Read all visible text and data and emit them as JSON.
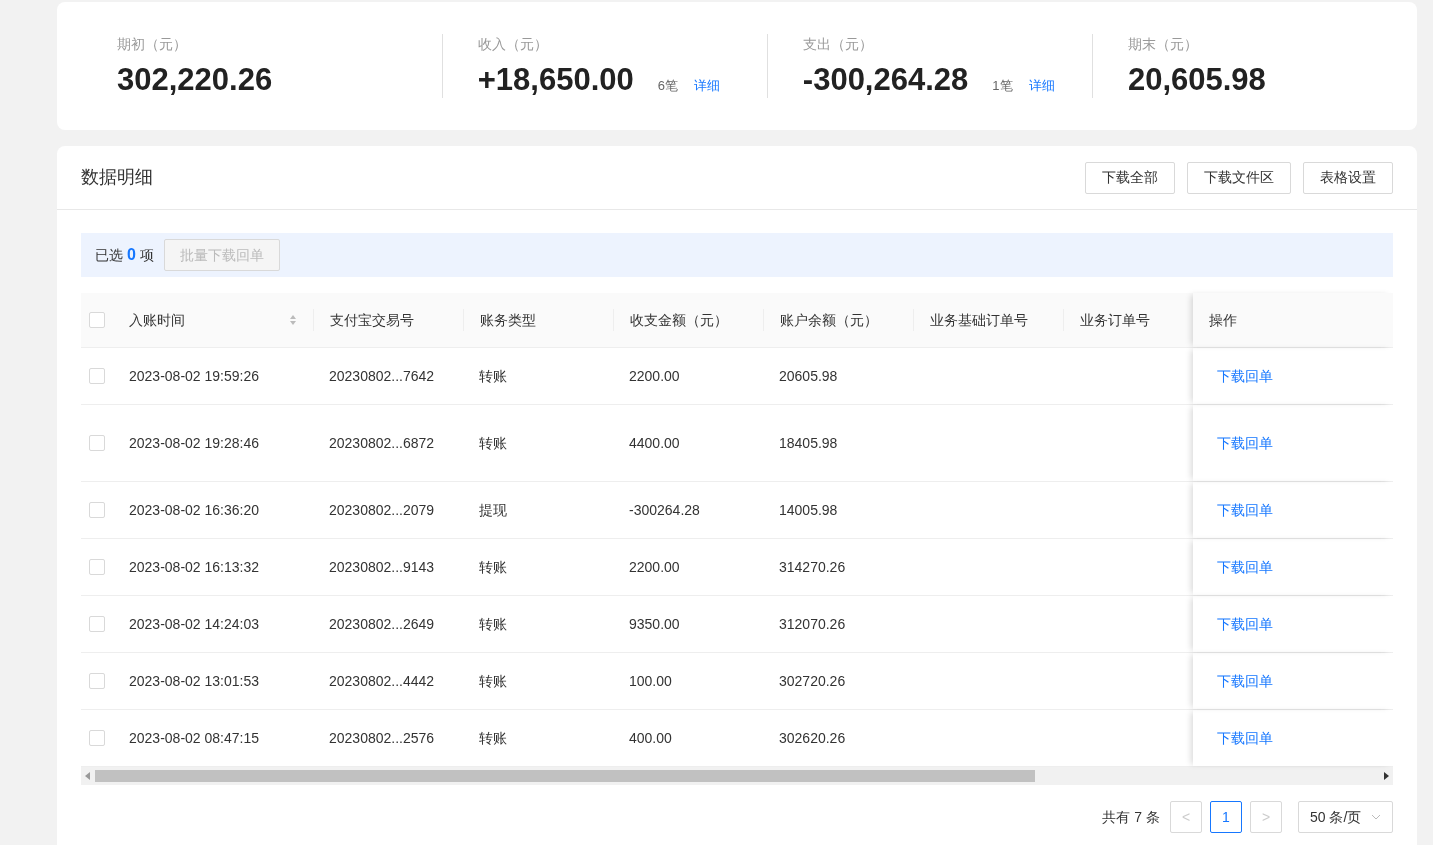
{
  "summary": [
    {
      "label": "期初（元）",
      "value": "302,220.26"
    },
    {
      "label": "收入（元）",
      "value": "+18,650.00",
      "count": "6笔",
      "link": "详细"
    },
    {
      "label": "支出（元）",
      "value": "-300,264.28",
      "count": "1笔",
      "link": "详细"
    },
    {
      "label": "期末（元）",
      "value": "20,605.98"
    }
  ],
  "detail": {
    "title": "数据明细",
    "buttons": [
      "下载全部",
      "下载文件区",
      "表格设置"
    ],
    "selection": {
      "prefix": "已选",
      "count": "0",
      "suffix": "项",
      "batch_button": {
        "label": "批量下载回单",
        "disabled": true
      }
    },
    "table": {
      "select_all": {
        "checked": false
      },
      "columns": [
        {
          "label": "入账时间",
          "sortable": true
        },
        {
          "label": "支付宝交易号",
          "sortable": false
        },
        {
          "label": "账务类型",
          "sortable": false
        },
        {
          "label": "收支金额（元）",
          "sortable": false
        },
        {
          "label": "账户余额（元）",
          "sortable": false
        },
        {
          "label": "业务基础订单号",
          "sortable": false
        },
        {
          "label": "业务订单号",
          "sortable": false
        },
        {
          "label": "操作",
          "sortable": false
        }
      ],
      "rows": [
        {
          "checked": false,
          "time": "2023-08-02 19:59:26",
          "trade_no": "20230802...7642",
          "type": "转账",
          "amount": "2200.00",
          "balance": "20605.98",
          "action": "下载回单"
        },
        {
          "checked": false,
          "time": "2023-08-02 19:28:46",
          "trade_no": "20230802...6872",
          "type": "转账",
          "amount": "4400.00",
          "balance": "18405.98",
          "action": "下载回单"
        },
        {
          "checked": false,
          "time": "2023-08-02 16:36:20",
          "trade_no": "20230802...2079",
          "type": "提现",
          "amount": "-300264.28",
          "balance": "14005.98",
          "action": "下载回单"
        },
        {
          "checked": false,
          "time": "2023-08-02 16:13:32",
          "trade_no": "20230802...9143",
          "type": "转账",
          "amount": "2200.00",
          "balance": "314270.26",
          "action": "下载回单"
        },
        {
          "checked": false,
          "time": "2023-08-02 14:24:03",
          "trade_no": "20230802...2649",
          "type": "转账",
          "amount": "9350.00",
          "balance": "312070.26",
          "action": "下载回单"
        },
        {
          "checked": false,
          "time": "2023-08-02 13:01:53",
          "trade_no": "20230802...4442",
          "type": "转账",
          "amount": "100.00",
          "balance": "302720.26",
          "action": "下载回单"
        },
        {
          "checked": false,
          "time": "2023-08-02 08:47:15",
          "trade_no": "20230802...2576",
          "type": "转账",
          "amount": "400.00",
          "balance": "302620.26",
          "action": "下载回单"
        }
      ]
    },
    "pagination": {
      "total": "共有 7 条",
      "prev": {
        "label": "<",
        "disabled": true
      },
      "pages": [
        {
          "label": "1",
          "selected": true
        }
      ],
      "next": {
        "label": ">",
        "disabled": true
      },
      "page_size": "50 条/页"
    }
  }
}
